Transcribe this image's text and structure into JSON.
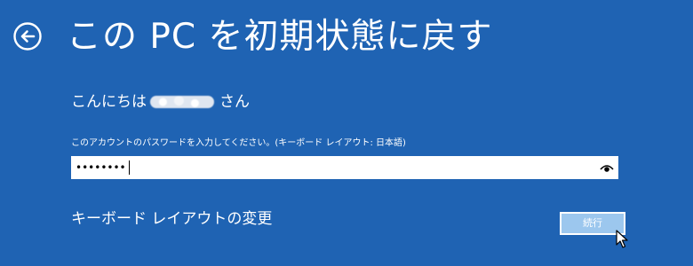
{
  "header": {
    "back_icon": "back-arrow-circle-icon",
    "title": "この PC を初期状態に戻す"
  },
  "greeting": {
    "prefix": "こんにちは",
    "suffix": "さん"
  },
  "password": {
    "label": "このアカウントのパスワードを入力してください。(キーボード レイアウト: 日本語)",
    "masked_value": "••••••••",
    "reveal_icon": "eye-icon"
  },
  "keyboard_link": "キーボード レイアウトの変更",
  "continue_button": "続行",
  "colors": {
    "background": "#1f63b3",
    "button": "#9cc7ee",
    "text": "#ffffff"
  }
}
